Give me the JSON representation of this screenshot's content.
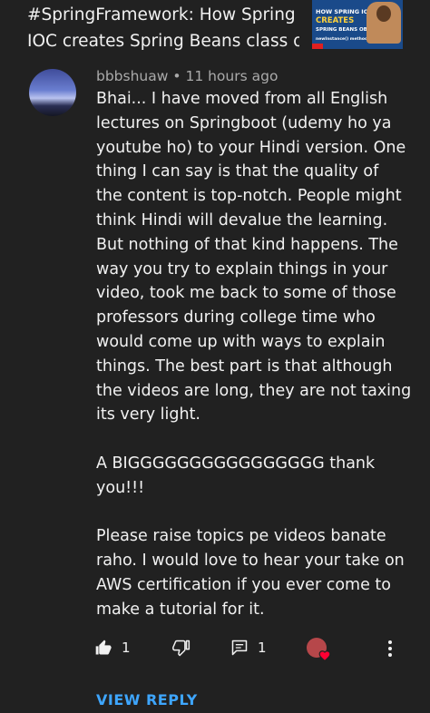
{
  "video": {
    "title_line1": "#SpringFramework: How Spring",
    "title_line2": "IOC creates Spring Beans class o…",
    "thumbnail": {
      "line1": "HOW SPRING IOC",
      "line2": "CREATES",
      "line3": "SPRING BEANS OBJECTS ?",
      "line4": "newInstance() method"
    }
  },
  "comment": {
    "author": "bbbshuaw",
    "separator": "•",
    "time": "11 hours ago",
    "lines": [
      "Bhai... I have moved from all English",
      "lectures on Springboot (udemy ho ya",
      "youtube ho) to your Hindi version. One",
      "thing I can say is that the quality of",
      "the content is top-notch. People might",
      "think Hindi will devalue the learning.",
      "But nothing of that kind happens. The",
      "way you try to explain things in your",
      "video, took me back to some of those",
      "professors during college time who",
      "would come up with ways to explain",
      "things. The best part is that although",
      "the videos are long, they are not taxing",
      "its very light.",
      "",
      "A BIGGGGGGGGGGGGGGGG thank",
      "you!!!",
      "",
      "Please raise topics pe videos banate",
      "raho. I would love to hear your take on",
      "AWS certification if you ever come to",
      "make a tutorial for it."
    ]
  },
  "actions": {
    "like_count": "1",
    "reply_count": "1",
    "like_icon": "thumbs-up-icon",
    "dislike_icon": "thumbs-down-icon",
    "reply_icon": "comment-icon",
    "more_icon": "more-vertical-icon"
  },
  "view_reply_label": "VIEW REPLY",
  "colors": {
    "background": "#212121",
    "text": "#f1f1f1",
    "meta": "#aaaaaa",
    "link": "#3ea6ff",
    "heart": "#ff0033"
  }
}
